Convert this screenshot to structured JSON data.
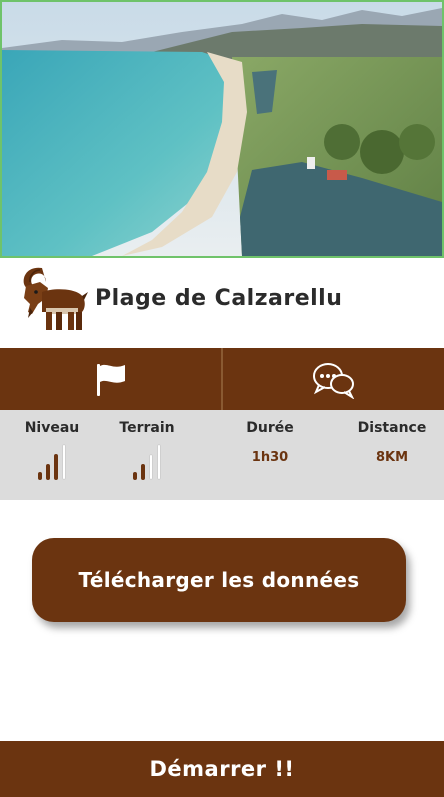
{
  "header": {
    "title": "Plage de Calzarellu",
    "hero_image": "aerial-beach-photo",
    "logo": "goat-icon"
  },
  "actions": [
    {
      "name": "flag-button",
      "icon": "flag-icon"
    },
    {
      "name": "comments-button",
      "icon": "chat-bubbles-icon"
    }
  ],
  "stats": {
    "niveau": {
      "label": "Niveau",
      "level": 3,
      "max": 4
    },
    "terrain": {
      "label": "Terrain",
      "level": 2,
      "max": 4
    },
    "duree": {
      "label": "Durée",
      "value": "1h30"
    },
    "distance": {
      "label": "Distance",
      "value": "8KM"
    }
  },
  "download_label": "Télécharger les données",
  "start_label": "Démarrer !!",
  "colors": {
    "brand": "#6b3410",
    "stats_bg": "#dcdcdc",
    "hero_border": "#6fc36a"
  }
}
